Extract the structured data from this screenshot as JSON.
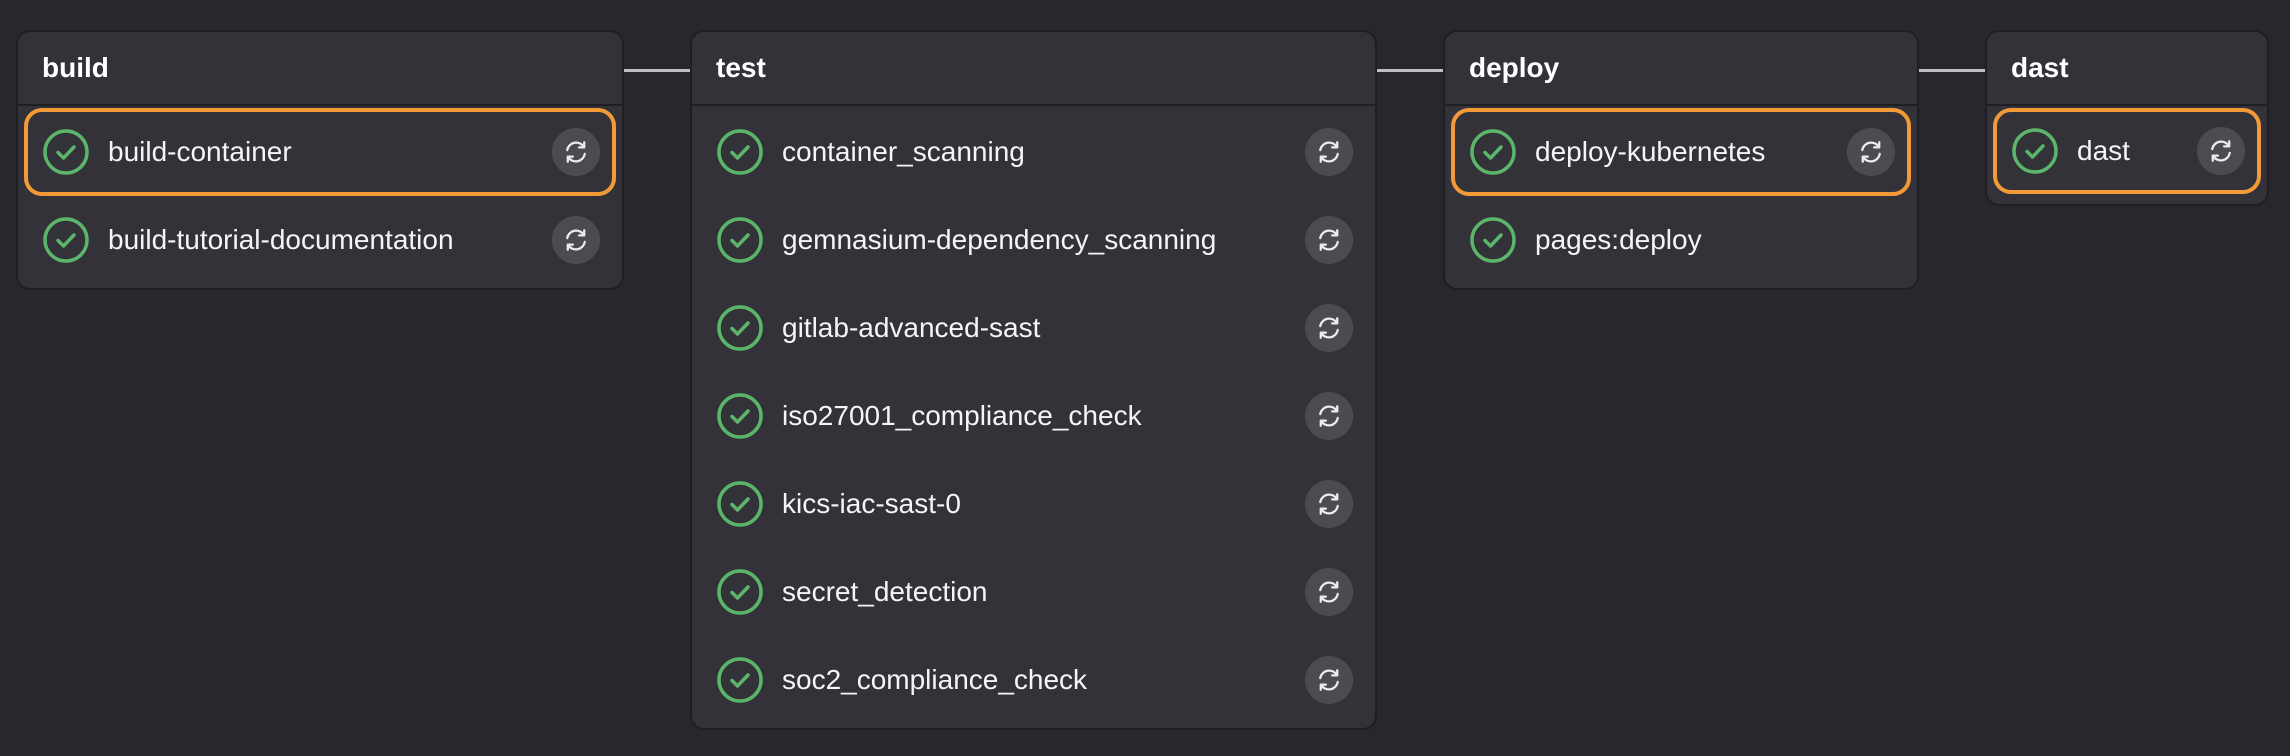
{
  "colors": {
    "background": "#28272d",
    "stage_bg": "#333238",
    "success": "#5bb56a",
    "highlight": "#f29a38"
  },
  "icons": {
    "status": "check-circle-icon",
    "action": "retry-icon"
  },
  "stages": [
    {
      "name": "build",
      "jobs": [
        {
          "name": "build-container",
          "status": "success",
          "highlighted": true,
          "retry": true
        },
        {
          "name": "build-tutorial-documentation",
          "status": "success",
          "highlighted": false,
          "retry": true
        }
      ]
    },
    {
      "name": "test",
      "jobs": [
        {
          "name": "container_scanning",
          "status": "success",
          "highlighted": false,
          "retry": true
        },
        {
          "name": "gemnasium-dependency_scanning",
          "status": "success",
          "highlighted": false,
          "retry": true
        },
        {
          "name": "gitlab-advanced-sast",
          "status": "success",
          "highlighted": false,
          "retry": true
        },
        {
          "name": "iso27001_compliance_check",
          "status": "success",
          "highlighted": false,
          "retry": true
        },
        {
          "name": "kics-iac-sast-0",
          "status": "success",
          "highlighted": false,
          "retry": true
        },
        {
          "name": "secret_detection",
          "status": "success",
          "highlighted": false,
          "retry": true
        },
        {
          "name": "soc2_compliance_check",
          "status": "success",
          "highlighted": false,
          "retry": true
        }
      ]
    },
    {
      "name": "deploy",
      "jobs": [
        {
          "name": "deploy-kubernetes",
          "status": "success",
          "highlighted": true,
          "retry": true
        },
        {
          "name": "pages:deploy",
          "status": "success",
          "highlighted": false,
          "retry": false
        }
      ]
    },
    {
      "name": "dast",
      "jobs": [
        {
          "name": "dast",
          "status": "success",
          "highlighted": true,
          "retry": true
        }
      ]
    }
  ]
}
